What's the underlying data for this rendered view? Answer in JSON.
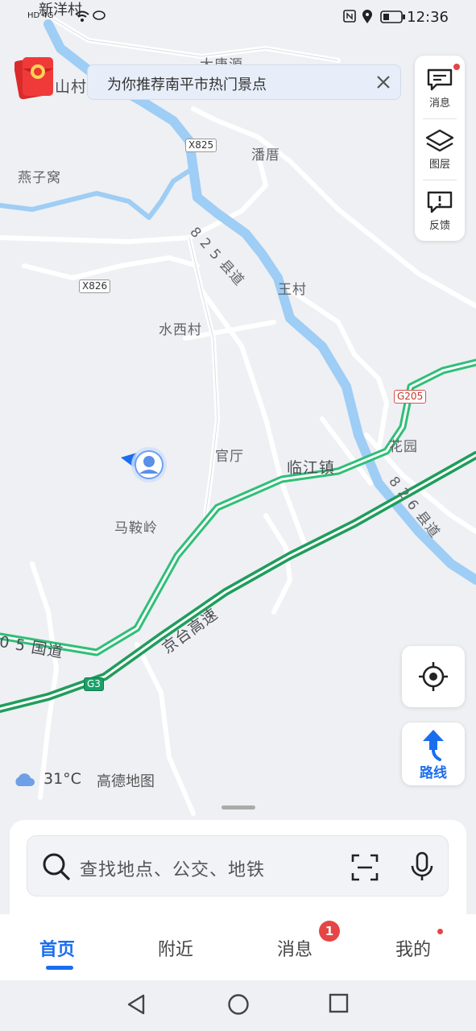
{
  "status_bar": {
    "left_label": "新洋村",
    "network": "HD 4G",
    "time": "12:36"
  },
  "banner": {
    "text": "为你推荐南平市热门景点"
  },
  "tools": {
    "messages": "消息",
    "layers": "图层",
    "feedback": "反馈"
  },
  "map": {
    "labels": {
      "shan_cun": "山村",
      "da_tang_yuan": "大唐源",
      "pan_cuo": "潘厝",
      "yan_zi_wo": "燕子窝",
      "wang_cun": "王村",
      "shui_xi_cun": "水西村",
      "guan_ting": "官厅",
      "lin_jiang_zhen": "临江镇",
      "hua_yuan": "花园",
      "ma_an_ling": "马鞍岭",
      "road_825": "8 2 5 县道",
      "road_826": "8 2 6 县道",
      "road_205": "0 5 国道",
      "jingtai": "京台高速"
    },
    "road_tags": {
      "x825": "X825",
      "x826": "X826",
      "g205": "G205",
      "g3": "G3"
    },
    "colors": {
      "river": "#9ecdf5",
      "highway": "#1f9d5b",
      "national_road": "#2fbf77",
      "background": "#eef0f3"
    }
  },
  "weather": {
    "temperature": "31°C",
    "provider": "高德地图"
  },
  "route_button": {
    "label": "路线"
  },
  "search": {
    "placeholder": "查找地点、公交、地铁"
  },
  "tabs": [
    {
      "label": "首页",
      "active": true
    },
    {
      "label": "附近",
      "active": false
    },
    {
      "label": "消息",
      "active": false,
      "badge": "1"
    },
    {
      "label": "我的",
      "active": false
    }
  ],
  "icons": {
    "red_packet": "red-envelope-icon",
    "close": "close-icon",
    "message": "message-icon",
    "layers": "layers-icon",
    "feedback": "feedback-icon",
    "locate": "locate-icon",
    "route": "route-arrow-icon",
    "cloud": "cloud-icon",
    "search": "search-icon",
    "scan": "scan-icon",
    "mic": "mic-icon"
  }
}
